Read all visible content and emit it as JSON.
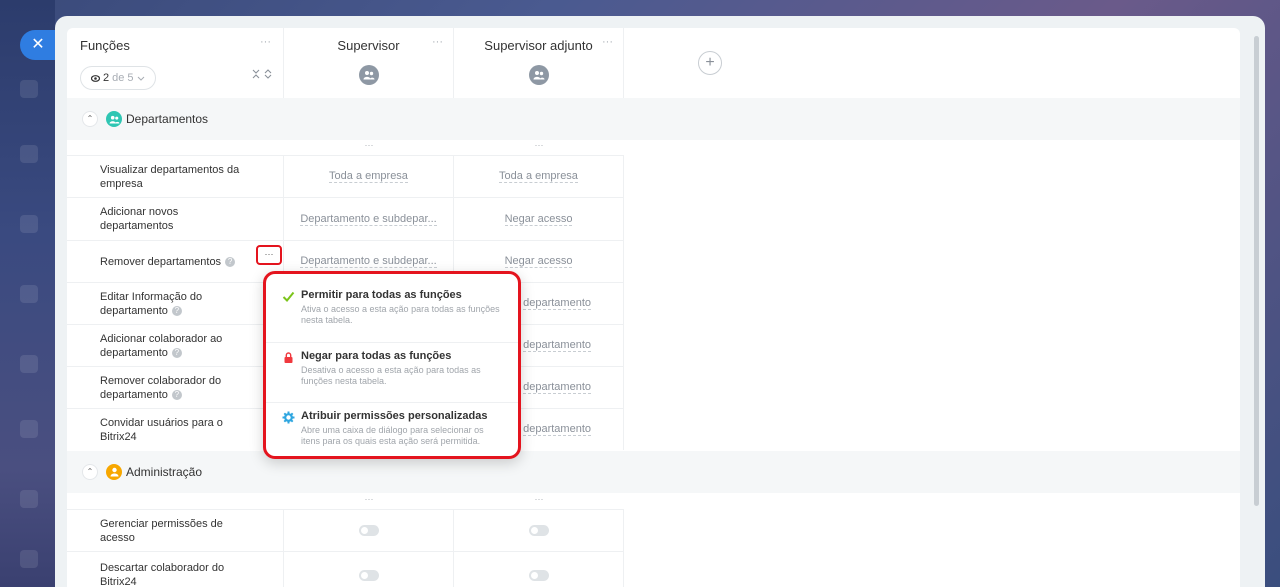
{
  "window": {
    "close_label": "✕"
  },
  "header": {
    "functions_title": "Funções",
    "counter_current": "2",
    "counter_rest": "de 5",
    "roles": [
      {
        "name": "Supervisor"
      },
      {
        "name": "Supervisor adjunto"
      }
    ],
    "add_role_label": "+",
    "more_label": "···"
  },
  "sections": [
    {
      "label": "Departamentos",
      "icon": "users-icon",
      "color": "#2fc6b3",
      "rows": [
        {
          "label": "Visualizar departamentos da empresa",
          "help": false,
          "sup": "Toda a empresa",
          "adj": "Toda a empresa"
        },
        {
          "label": "Adicionar novos departamentos",
          "help": false,
          "sup": "Departamento e subdepar...",
          "adj": "Negar acesso"
        },
        {
          "label": "Remover departamentos",
          "help": true,
          "sup": "Departamento e subdepar...",
          "adj": "Negar acesso"
        },
        {
          "label": "Editar Informação do departamento",
          "help": true,
          "sup": "",
          "adj": "rio departamento"
        },
        {
          "label": "Adicionar colaborador ao departamento",
          "help": true,
          "sup": "",
          "adj": "rio departamento"
        },
        {
          "label": "Remover colaborador do departamento",
          "help": true,
          "sup": "",
          "adj": "rio departamento"
        },
        {
          "label": "Convidar usuários para o Bitrix24",
          "help": false,
          "sup": "",
          "adj": "rio departamento"
        }
      ]
    },
    {
      "label": "Administração",
      "icon": "person-icon",
      "color": "#f7a700",
      "rows": [
        {
          "label": "Gerenciar permissões de acesso",
          "help": false
        },
        {
          "label": "Descartar colaborador do Bitrix24",
          "help": false
        }
      ]
    }
  ],
  "popup": {
    "items": [
      {
        "title": "Permitir para todas as funções",
        "desc": "Ativa o acesso a esta ação para todas as funções nesta tabela.",
        "icon": "check-icon",
        "color": "#7bc41a"
      },
      {
        "title": "Negar para todas as funções",
        "desc": "Desativa o acesso a esta ação para todas as funções nesta tabela.",
        "icon": "lock-icon",
        "color": "#f0383e"
      },
      {
        "title": "Atribuir permissões personalizadas",
        "desc": "Abre uma caixa de diálogo para selecionar os itens para os quais esta ação será permitida.",
        "icon": "gear-icon",
        "color": "#2fa6e0"
      }
    ]
  }
}
